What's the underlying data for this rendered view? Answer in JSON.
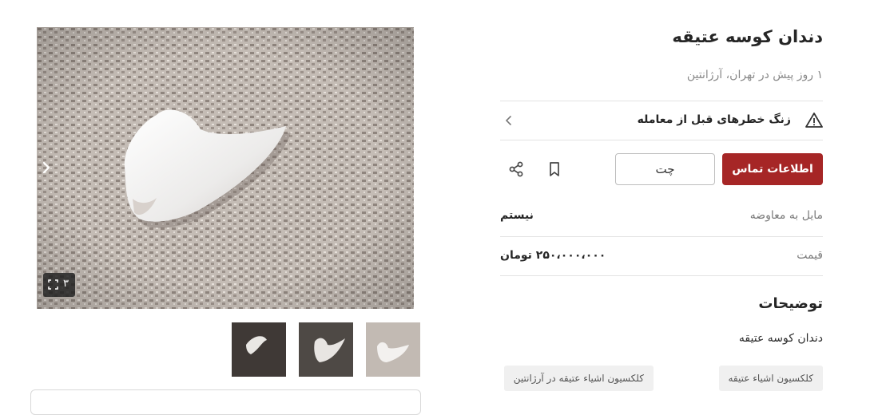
{
  "listing": {
    "title": "دندان کوسه عتیقه",
    "subtitle": "۱ روز پیش در تهران، آرژانتین"
  },
  "warning": {
    "text": "زنگ خطرهای قبل از معامله",
    "icon": "warning-triangle-icon"
  },
  "actions": {
    "contact_label": "اطلاعات تماس",
    "chat_label": "چت",
    "bookmark_icon": "bookmark-icon",
    "share_icon": "share-icon"
  },
  "details": [
    {
      "key": "مایل به معاوضه",
      "value": "نیستم"
    },
    {
      "key": "قیمت",
      "value": "۲۵۰،۰۰۰،۰۰۰ تومان"
    }
  ],
  "description": {
    "heading": "توضیحات",
    "text": "دندان کوسه عتیقه"
  },
  "tags": [
    "کلکسیون اشیاء عتیقه",
    "کلکسیون اشیاء عتیقه در آرژانتین"
  ],
  "gallery": {
    "image_count": "۳",
    "fullscreen_icon": "fullscreen-icon",
    "next_icon": "chevron-right-icon",
    "thumbnails": [
      "thumbnail-1",
      "thumbnail-2",
      "thumbnail-3"
    ]
  },
  "colors": {
    "accent": "#a62626",
    "text_primary": "#262626",
    "text_secondary": "#8a8a8a",
    "divider": "#e3e3e3",
    "tag_bg": "#f0f0f0"
  }
}
